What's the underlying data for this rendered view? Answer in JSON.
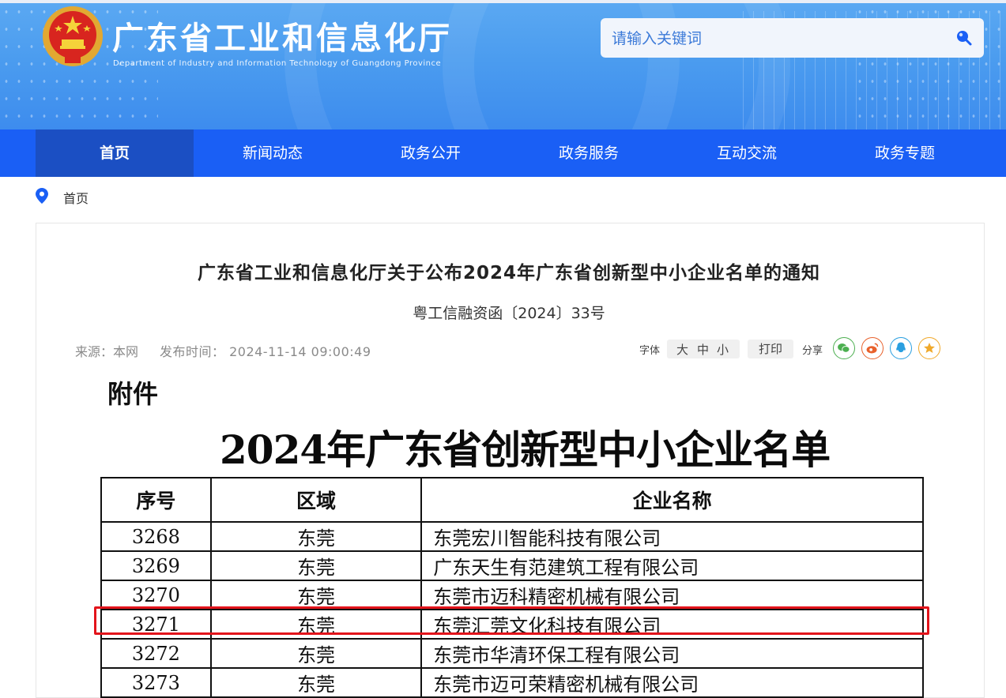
{
  "header": {
    "title": "广东省工业和信息化厅",
    "subtitle": "Department of Industry and Information Technology of Guangdong Province",
    "emblem_icon": "national-emblem-icon",
    "search": {
      "placeholder": "请输入关键词",
      "icon": "search-icon"
    }
  },
  "nav": {
    "items": [
      {
        "label": "首页",
        "active": true
      },
      {
        "label": "新闻动态"
      },
      {
        "label": "政务公开"
      },
      {
        "label": "政务服务"
      },
      {
        "label": "互动交流"
      },
      {
        "label": "政务专题"
      }
    ]
  },
  "breadcrumb": {
    "icon": "location-pin-icon",
    "label": "首页"
  },
  "article": {
    "title": "广东省工业和信息化厅关于公布2024年广东省创新型中小企业名单的通知",
    "doc_number": "粤工信融资函〔2024〕33号",
    "source": "来源：本网",
    "publish_time": "发布时间： 2024-11-14 09:00:49",
    "tools": {
      "font_label": "字体",
      "font_sizes": [
        "大",
        "中",
        "小"
      ],
      "print_label": "打印",
      "share_label": "分享",
      "share_icons": [
        "wechat-icon",
        "weibo-icon",
        "qq-icon",
        "favorite-star-icon"
      ]
    }
  },
  "attachment": {
    "label": "附件",
    "heading": "2024年广东省创新型中小企业名单",
    "table": {
      "headers": [
        "序号",
        "区域",
        "企业名称"
      ],
      "rows": [
        [
          "3268",
          "东莞",
          "东莞宏川智能科技有限公司"
        ],
        [
          "3269",
          "东莞",
          "广东天生有范建筑工程有限公司"
        ],
        [
          "3270",
          "东莞",
          "东莞市迈科精密机械有限公司"
        ],
        [
          "3271",
          "东莞",
          "东莞汇莞文化科技有限公司"
        ],
        [
          "3272",
          "东莞",
          "东莞市华清环保工程有限公司"
        ],
        [
          "3273",
          "东莞",
          "东莞市迈可荣精密机械有限公司"
        ]
      ],
      "highlighted_row": "3271"
    }
  },
  "colors": {
    "header_blue": "#4b9cef",
    "nav_blue": "#1a5ff5",
    "nav_active": "#1b4fc3",
    "highlight_red": "#e3141b"
  }
}
